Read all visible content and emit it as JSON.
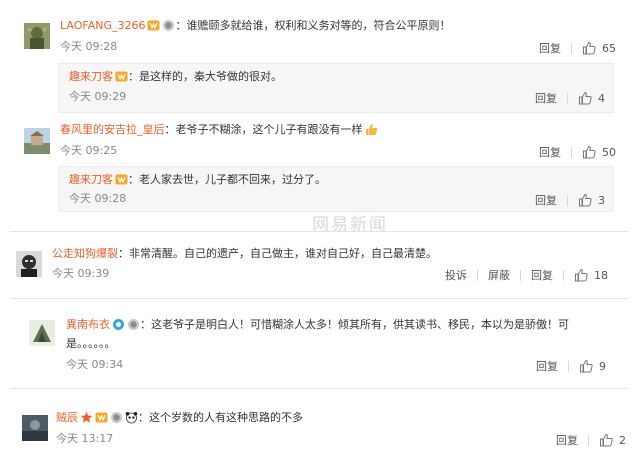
{
  "actions": {
    "reply": "回复",
    "report": "投诉",
    "block": "屏蔽"
  },
  "watermark": "网易新闻",
  "comments": [
    {
      "user": "LAOFANG_3266",
      "text": "：谁赡颐多就给谁，权利和义务对等的，符合公平原则！",
      "time": "今天 09:28",
      "likes": "65",
      "replies": [
        {
          "user": "趣来刀客",
          "text": "：是这样的，秦大爷做的很对。",
          "time": "今天 09:29",
          "likes": "4"
        }
      ]
    },
    {
      "user": "春风里的安吉拉_皇后",
      "text": "：老爷子不糊涂，这个儿子有跟没有一样",
      "time": "今天 09:25",
      "likes": "50",
      "replies": [
        {
          "user": "趣来刀客",
          "text": "：老人家去世，儿子都不回来，过分了。",
          "time": "今天 09:28",
          "likes": "3"
        }
      ]
    },
    {
      "user": "公走知狗爆裂",
      "text": "：非常清醒。自己的遗产，自己做主，谁对自己好，自己最清楚。",
      "time": "今天 09:39",
      "likes": "18"
    },
    {
      "user": "異南布衣",
      "text": "：这老爷子是明白人！可惜糊涂人太多！倾其所有，供其读书、移民，本以为是骄傲！可",
      "text2": "是。。。。。。",
      "time": "今天 09:34",
      "likes": "9"
    },
    {
      "user": "贼辰",
      "text": "：这个岁数的人有这种思路的不多",
      "time": "今天 13:17",
      "likes": "2"
    }
  ]
}
